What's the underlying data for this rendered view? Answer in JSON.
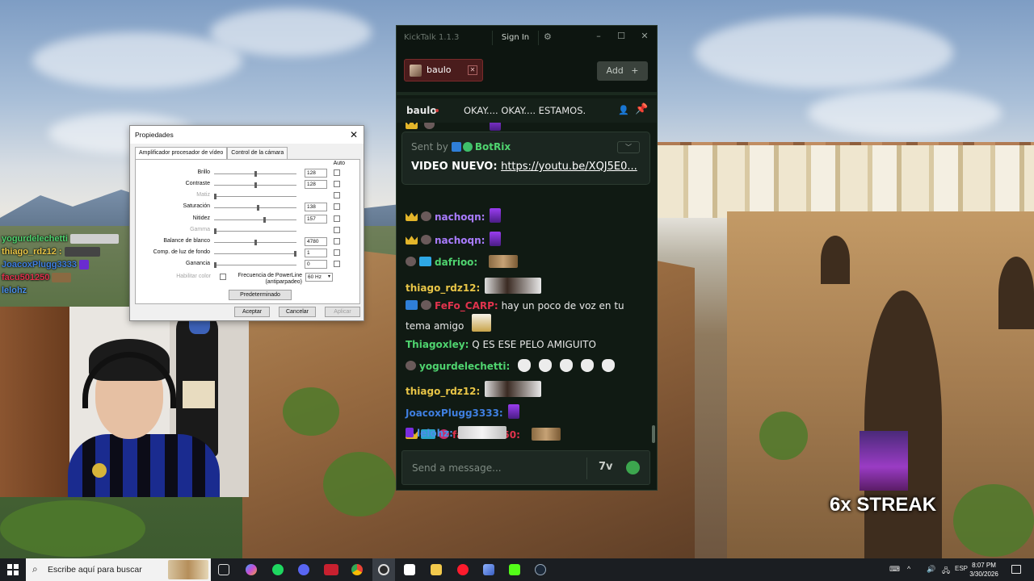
{
  "overlay_chat": [
    {
      "user": "yogurdelechetti",
      "color": "#4fd46f"
    },
    {
      "user": "thiago_rdz12",
      "color": "#e8c547"
    },
    {
      "user": "JoacoxPlugg3333",
      "color": "#3f7fe0"
    },
    {
      "user": "facu501250",
      "color": "#e0334d"
    },
    {
      "user": "lelohz",
      "color": "#4a8fe8"
    }
  ],
  "dialog": {
    "title": "Propiedades",
    "tabs": [
      "Amplificador procesador de vídeo",
      "Control de la cámara"
    ],
    "auto_label": "Auto",
    "rows": [
      {
        "label": "Brillo",
        "value": "128",
        "level": 0.5,
        "disabled": false
      },
      {
        "label": "Contraste",
        "value": "128",
        "level": 0.5,
        "disabled": false
      },
      {
        "label": "Matiz",
        "value": "",
        "level": 0.0,
        "disabled": true
      },
      {
        "label": "Saturación",
        "value": "138",
        "level": 0.54,
        "disabled": false
      },
      {
        "label": "Nitidez",
        "value": "157",
        "level": 0.62,
        "disabled": false
      },
      {
        "label": "Gamma",
        "value": "",
        "level": 0.0,
        "disabled": true
      },
      {
        "label": "Balance de blanco",
        "value": "4780",
        "level": 0.5,
        "disabled": false
      },
      {
        "label": "Comp. de luz de fondo",
        "value": "1",
        "level": 1.0,
        "disabled": false
      },
      {
        "label": "Ganancia",
        "value": "0",
        "level": 0.0,
        "disabled": false
      }
    ],
    "color_enable": "Habilitar color",
    "powerline_label": "Frecuencia de PowerLine (antiparpadeo)",
    "powerline_value": "60 Hz",
    "default_btn": "Predeterminado",
    "accept_btn": "Aceptar",
    "cancel_btn": "Cancelar",
    "apply_btn": "Aplicar"
  },
  "kicktalk": {
    "title": "KickTalk 1.1.3",
    "signin": "Sign In",
    "channel_tab": "baulo",
    "add_label": "Add",
    "header_name": "baulo",
    "header_title": "OKAY.... OKAY.... ESTAMOS.",
    "pinned": {
      "sent_by": "Sent by",
      "bot": "BotRix",
      "prefix": "VIDEO NUEVO:",
      "link": "https://youtu.be/XQJ5E0..."
    },
    "messages": [
      {
        "user": "nachoqn:",
        "color": "#a97cff",
        "text": ""
      },
      {
        "user": "nachoqn:",
        "color": "#a97cff",
        "text": ""
      },
      {
        "user": "dafrioo:",
        "color": "#4fd46f",
        "text": ""
      },
      {
        "user": "thiago_rdz12:",
        "color": "#e8c547",
        "text": ""
      },
      {
        "user": "FeFo_CARP:",
        "color": "#e0334d",
        "text": "hay un poco de voz en tu tema amigo"
      },
      {
        "user": "Thiagoxley:",
        "color": "#4fd46f",
        "text": "Q ES ESE PELO AMIGUITO"
      },
      {
        "user": "yogurdelechetti:",
        "color": "#4fd46f",
        "text": ""
      },
      {
        "user": "thiago_rdz12:",
        "color": "#e8c547",
        "text": ""
      },
      {
        "user": "JoacoxPlugg3333:",
        "color": "#3f7fe0",
        "text": ""
      },
      {
        "user": "facu501250:",
        "color": "#e0334d",
        "text": ""
      },
      {
        "user": "lelohz:",
        "color": "#4a8fe8",
        "text": ""
      }
    ],
    "input_placeholder": "Send a message...",
    "seventv": "7v"
  },
  "streak": "6x STREAK",
  "taskbar": {
    "search_placeholder": "Escribe aquí para buscar",
    "lang": "ESP",
    "time": "8:07 PM",
    "date": "3/30/2026"
  }
}
